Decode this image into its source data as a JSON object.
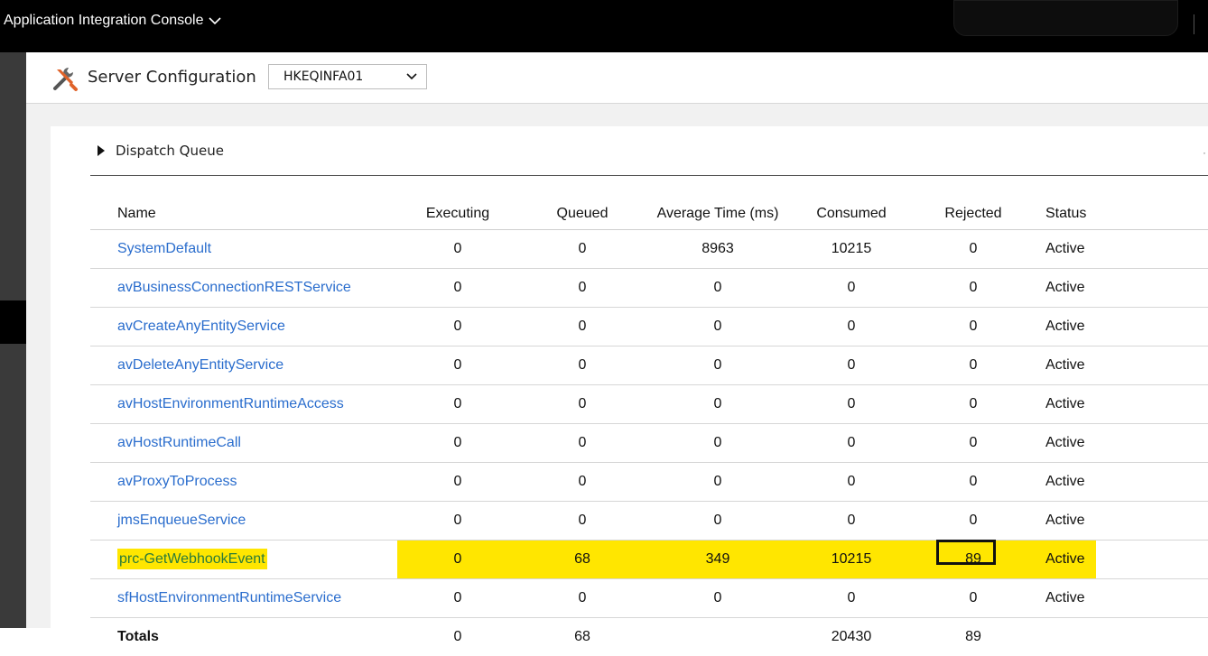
{
  "topbar": {
    "app_title": "Application Integration Console"
  },
  "header": {
    "title": "Server Configuration",
    "server_selected": "HKEQINFA01"
  },
  "section": {
    "title": "Dispatch Queue"
  },
  "table": {
    "columns": [
      "Name",
      "Executing",
      "Queued",
      "Average Time (ms)",
      "Consumed",
      "Rejected",
      "Status"
    ],
    "rows": [
      {
        "name": "SystemDefault",
        "executing": "0",
        "queued": "0",
        "avg": "8963",
        "consumed": "10215",
        "rejected": "0",
        "status": "Active"
      },
      {
        "name": "avBusinessConnectionRESTService",
        "executing": "0",
        "queued": "0",
        "avg": "0",
        "consumed": "0",
        "rejected": "0",
        "status": "Active"
      },
      {
        "name": "avCreateAnyEntityService",
        "executing": "0",
        "queued": "0",
        "avg": "0",
        "consumed": "0",
        "rejected": "0",
        "status": "Active"
      },
      {
        "name": "avDeleteAnyEntityService",
        "executing": "0",
        "queued": "0",
        "avg": "0",
        "consumed": "0",
        "rejected": "0",
        "status": "Active"
      },
      {
        "name": "avHostEnvironmentRuntimeAccess",
        "executing": "0",
        "queued": "0",
        "avg": "0",
        "consumed": "0",
        "rejected": "0",
        "status": "Active"
      },
      {
        "name": "avHostRuntimeCall",
        "executing": "0",
        "queued": "0",
        "avg": "0",
        "consumed": "0",
        "rejected": "0",
        "status": "Active"
      },
      {
        "name": "avProxyToProcess",
        "executing": "0",
        "queued": "0",
        "avg": "0",
        "consumed": "0",
        "rejected": "0",
        "status": "Active"
      },
      {
        "name": "jmsEnqueueService",
        "executing": "0",
        "queued": "0",
        "avg": "0",
        "consumed": "0",
        "rejected": "0",
        "status": "Active"
      },
      {
        "name": "prc-GetWebhookEvent",
        "executing": "0",
        "queued": "68",
        "avg": "349",
        "consumed": "10215",
        "rejected": "89",
        "status": "Active"
      },
      {
        "name": "sfHostEnvironmentRuntimeService",
        "executing": "0",
        "queued": "0",
        "avg": "0",
        "consumed": "0",
        "rejected": "0",
        "status": "Active"
      }
    ],
    "totals": {
      "label": "Totals",
      "executing": "0",
      "queued": "68",
      "avg": "",
      "consumed": "20430",
      "rejected": "89",
      "status": ""
    }
  },
  "colors": {
    "highlight": "#ffe600",
    "link": "#2a6dcd",
    "highlight_link": "#2a7a3a",
    "topbar": "#000000"
  },
  "icons": {
    "header": "tools-icon",
    "app_menu": "chevron-down-icon",
    "section": "triangle-right-icon"
  }
}
